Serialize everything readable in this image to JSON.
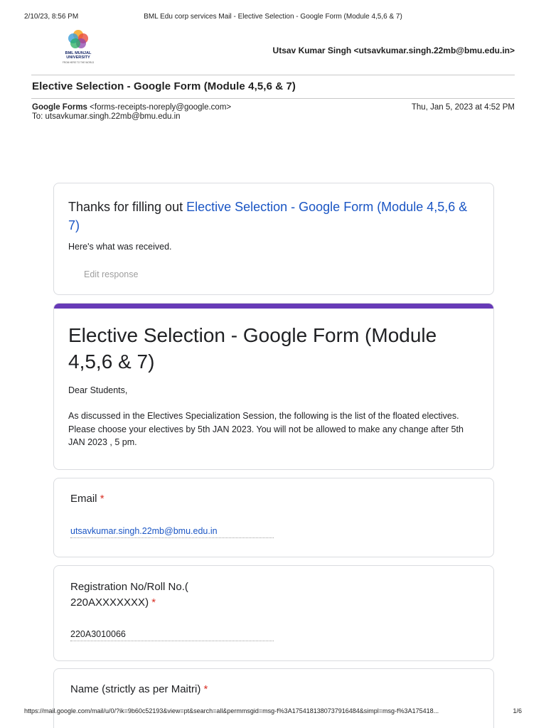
{
  "print_header": {
    "datetime": "2/10/23, 8:56 PM",
    "title": "BML Edu corp services Mail - Elective Selection - Google Form (Module 4,5,6 & 7)"
  },
  "logo": {
    "name_line1": "BML MUNJAL",
    "name_line2": "UNIVERSITY",
    "tagline": "FROM HERE TO THE WORLD"
  },
  "account": "Utsav Kumar Singh <utsavkumar.singh.22mb@bmu.edu.in>",
  "email": {
    "subject": "Elective Selection - Google Form (Module 4,5,6 & 7)",
    "from_name": "Google Forms",
    "from_address": "<forms-receipts-noreply@google.com>",
    "date": "Thu, Jan 5, 2023 at 4:52 PM",
    "to": "To: utsavkumar.singh.22mb@bmu.edu.in"
  },
  "thanks_card": {
    "prefix": "Thanks for filling out ",
    "form_link": "Elective Selection - Google Form (Module 4,5,6 & 7)",
    "subtitle": "Here's what was received.",
    "edit_label": "Edit response"
  },
  "form": {
    "title": "Elective Selection - Google Form (Module 4,5,6 & 7)",
    "greeting": "Dear Students,",
    "description": "As discussed in the Electives Specialization Session, the following is the list of the floated electives. Please choose your electives by 5th JAN 2023. You will not be allowed to make any change after 5th JAN 2023 , 5 pm."
  },
  "questions": [
    {
      "label": "Email",
      "required": "*",
      "answer": "utsavkumar.singh.22mb@bmu.edu.in"
    },
    {
      "label": "Registration No/Roll No.( 220AXXXXXXX)",
      "required": "*",
      "answer": "220A3010066"
    },
    {
      "label": "Name (strictly as per Maitri)",
      "required": "*"
    }
  ],
  "print_footer": {
    "url": "https://mail.google.com/mail/u/0/?ik=9b60c52193&view=pt&search=all&permmsgid=msg-f%3A1754181380737916484&simpl=msg-f%3A175418...",
    "page": "1/6"
  },
  "colors": {
    "accent": "#673ab7",
    "link": "#1a55c4",
    "required": "#d93025"
  }
}
